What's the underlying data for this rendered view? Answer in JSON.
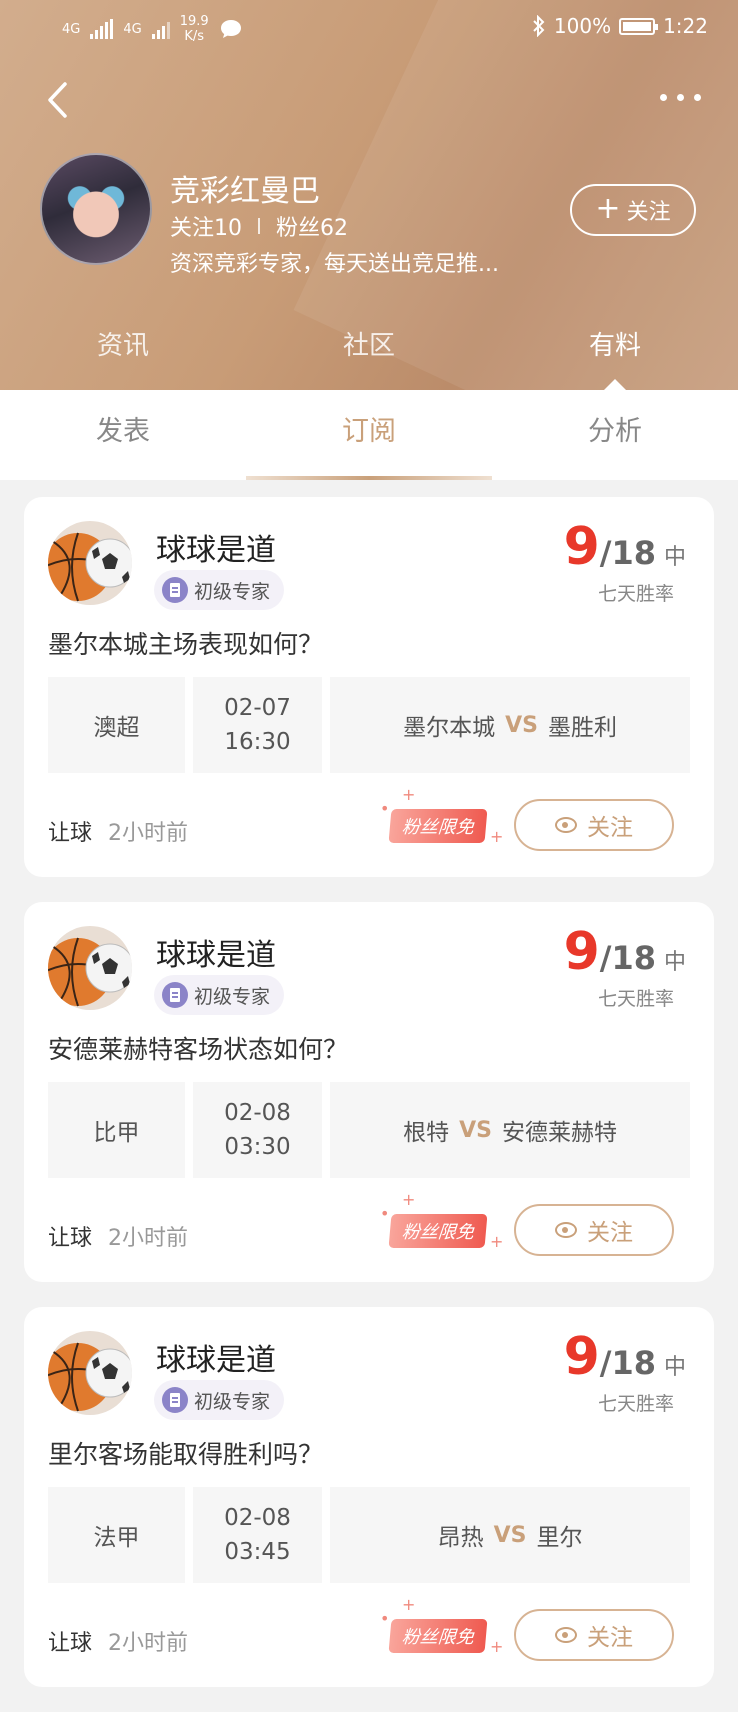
{
  "status_bar": {
    "network1": "4G",
    "network2": "4G",
    "speed_value": "19.9",
    "speed_unit": "K/s",
    "battery_percent": "100%",
    "time": "1:22"
  },
  "profile": {
    "name": "竞彩红曼巴",
    "following": "关注10",
    "fans": "粉丝62",
    "description": "资深竞彩专家，每天送出竞足推...",
    "follow_label": "关注",
    "follow_plus": "+"
  },
  "main_tabs": [
    {
      "label": "资讯",
      "active": false
    },
    {
      "label": "社区",
      "active": false
    },
    {
      "label": "有料",
      "active": true
    }
  ],
  "sub_tabs": [
    {
      "label": "发表",
      "active": false
    },
    {
      "label": "订阅",
      "active": true
    },
    {
      "label": "分析",
      "active": false
    }
  ],
  "cards": [
    {
      "author": "球球是道",
      "badge": "初级专家",
      "hit": "9",
      "total": "/18",
      "suffix": "中",
      "rate_label": "七天胜率",
      "question": "墨尔本城主场表现如何？",
      "league": "澳超",
      "date": "02-07",
      "time": "16:30",
      "home": "墨尔本城",
      "vs": "VS",
      "away": "墨胜利",
      "tag": "让球",
      "ago": "2小时前",
      "promo": "粉丝限免",
      "watch": "关注"
    },
    {
      "author": "球球是道",
      "badge": "初级专家",
      "hit": "9",
      "total": "/18",
      "suffix": "中",
      "rate_label": "七天胜率",
      "question": "安德莱赫特客场状态如何？",
      "league": "比甲",
      "date": "02-08",
      "time": "03:30",
      "home": "根特",
      "vs": "VS",
      "away": "安德莱赫特",
      "tag": "让球",
      "ago": "2小时前",
      "promo": "粉丝限免",
      "watch": "关注"
    },
    {
      "author": "球球是道",
      "badge": "初级专家",
      "hit": "9",
      "total": "/18",
      "suffix": "中",
      "rate_label": "七天胜率",
      "question": "里尔客场能取得胜利吗？",
      "league": "法甲",
      "date": "02-08",
      "time": "03:45",
      "home": "昂热",
      "vs": "VS",
      "away": "里尔",
      "tag": "让球",
      "ago": "2小时前",
      "promo": "粉丝限免",
      "watch": "关注"
    }
  ],
  "colors": {
    "accent": "#c9a07a",
    "score_red": "#e8382a",
    "header_gradient_start": "#d2ad8d",
    "header_gradient_end": "#bb8c6a"
  },
  "icons": {
    "back": "back-arrow-icon",
    "more": "more-dots-icon",
    "eye": "eye-icon",
    "badge": "expert-badge-icon"
  }
}
